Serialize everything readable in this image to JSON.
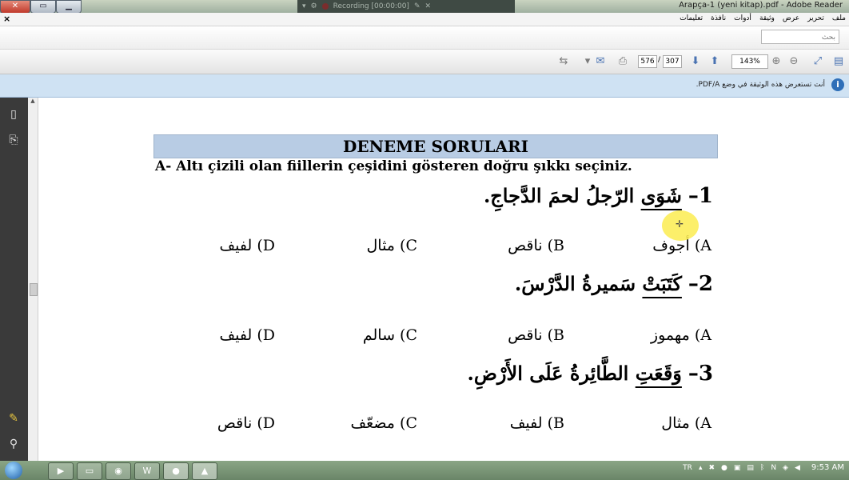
{
  "window": {
    "title": "Arapça-1 (yeni kitap).pdf - Adobe Reader",
    "recording_label": "Recording [00:00:00]"
  },
  "menu": {
    "items": [
      "ملف",
      "تحرير",
      "عرض",
      "وثيقة",
      "أدوات",
      "نافذة",
      "تعليمات"
    ]
  },
  "search": {
    "placeholder": "بحث"
  },
  "toolbar": {
    "current_page": "576",
    "page_sep": "/",
    "total_pages": "307",
    "zoom": "143%"
  },
  "infobar": {
    "message": "أنت تستعرض هذه الوثيقة في وضع PDF/A."
  },
  "document": {
    "title": "DENEME SORULARI",
    "instruction": "A- Altı çizili olan fiillerin çeşidini gösteren doğru şıkkı seçiniz.",
    "questions": [
      {
        "number": "1–",
        "verb": "شَوَى",
        "rest": " الرّجلُ لحمَ الدَّجاجِ.",
        "options": [
          "A) أجوف",
          "B) ناقص",
          "C) مثال",
          "D) لفيف"
        ]
      },
      {
        "number": "2–",
        "verb": "كَتَبَتْ",
        "rest": " سَميرةُ الدَّرْسَ.",
        "options": [
          "A) مهموز",
          "B) ناقص",
          "C) سالم",
          "D) لفيف"
        ]
      },
      {
        "number": "3–",
        "verb": "وَقَعَتِ",
        "rest": " الطَّائِرةُ عَلَى الأَرْضِ.",
        "options": [
          "A) مثال",
          "B) لفيف",
          "C) مضعّف",
          "D) ناقص"
        ]
      }
    ]
  },
  "taskbar": {
    "language": "TR",
    "clock": "9:53 AM"
  }
}
